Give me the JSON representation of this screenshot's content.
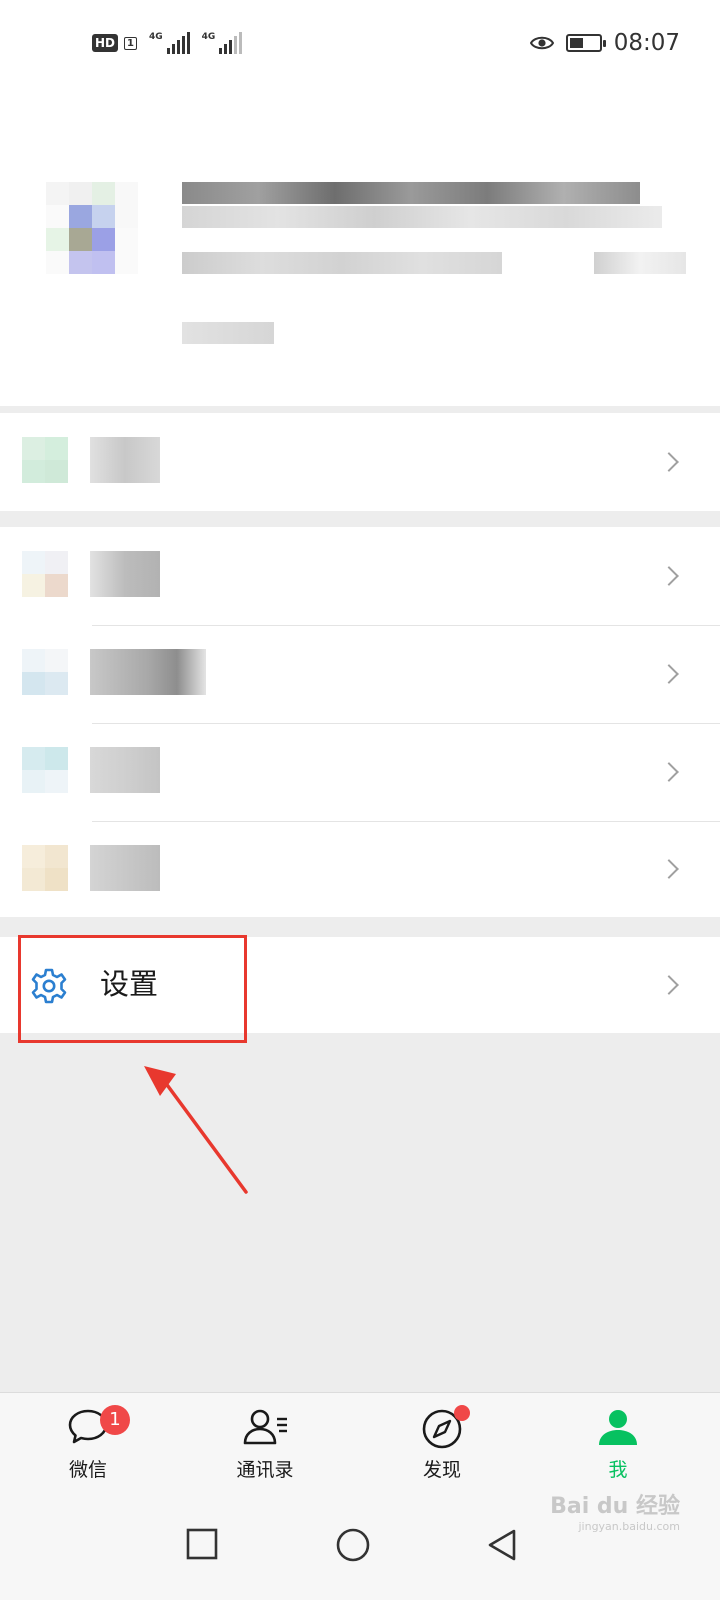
{
  "status_bar": {
    "time": "08:07",
    "hd_label": "HD",
    "sim_label": "1",
    "network_1": "4G",
    "network_2": "4G",
    "eye_icon": "eye-icon",
    "battery_level": 0.42
  },
  "menu": {
    "settings_label": "设置",
    "chevron_icon": "chevron-right-icon",
    "gear_icon": "gear-icon"
  },
  "tabbar": {
    "tabs": [
      {
        "label": "微信",
        "icon": "chat-bubble-icon",
        "badge": "1",
        "active": false
      },
      {
        "label": "通讯录",
        "icon": "contacts-icon",
        "active": false
      },
      {
        "label": "发现",
        "icon": "compass-icon",
        "dot": true,
        "active": false
      },
      {
        "label": "我",
        "icon": "person-icon",
        "active": true
      }
    ]
  },
  "navbar": {
    "buttons": [
      "recents-button",
      "home-button",
      "back-button"
    ]
  },
  "annotation": {
    "color": "#e8382e"
  },
  "colors": {
    "accent_green": "#07c160",
    "badge_red": "#f04848",
    "gear_blue": "#2b7fd0"
  },
  "watermark": {
    "text": "Bai du 经验",
    "sub": "jingyan.baidu.com"
  }
}
